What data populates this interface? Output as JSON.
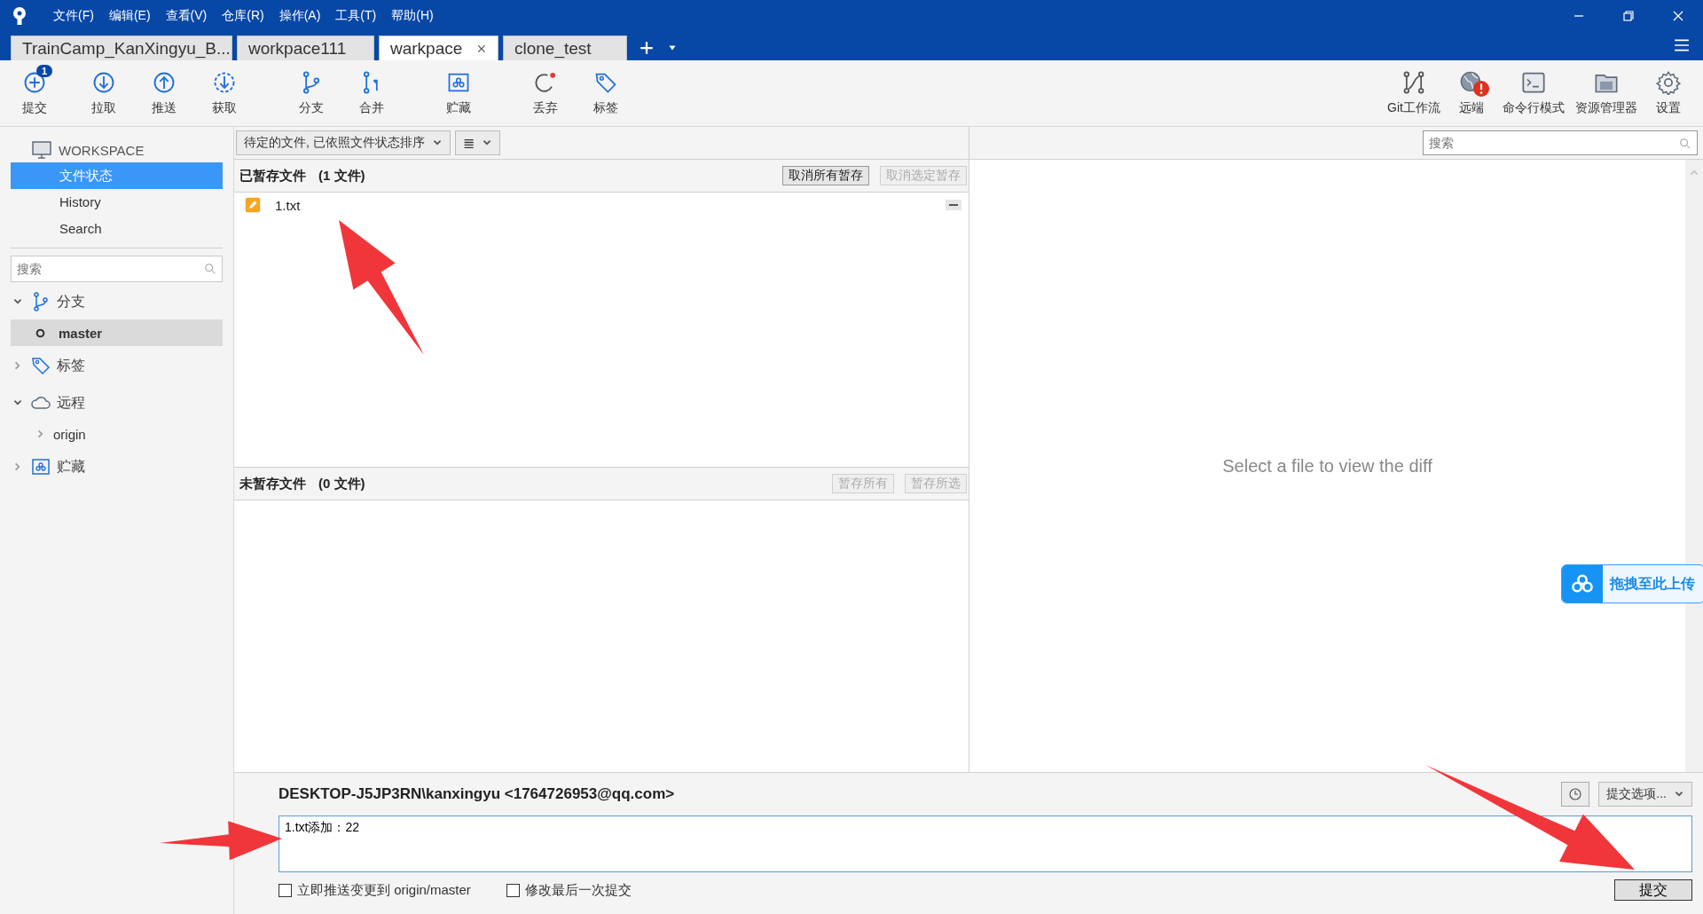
{
  "menu": [
    "文件(F)",
    "编辑(E)",
    "查看(V)",
    "仓库(R)",
    "操作(A)",
    "工具(T)",
    "帮助(H)"
  ],
  "tabs": [
    {
      "label": "TrainCamp_KanXingyu_B...",
      "selected": false
    },
    {
      "label": "workpace111",
      "selected": false
    },
    {
      "label": "warkpace",
      "selected": true
    },
    {
      "label": "clone_test",
      "selected": false
    }
  ],
  "toolbar_left": [
    {
      "label": "提交",
      "kind": "commit",
      "badge": "1"
    },
    {
      "label": "拉取",
      "kind": "pull"
    },
    {
      "label": "推送",
      "kind": "push"
    },
    {
      "label": "获取",
      "kind": "fetch"
    },
    {
      "label": "分支",
      "kind": "branch"
    },
    {
      "label": "合并",
      "kind": "merge"
    },
    {
      "label": "贮藏",
      "kind": "stash"
    },
    {
      "label": "丢弃",
      "kind": "discard"
    },
    {
      "label": "标签",
      "kind": "tag"
    }
  ],
  "toolbar_right": [
    {
      "label": "Git工作流",
      "kind": "flow",
      "alert": false
    },
    {
      "label": "远端",
      "kind": "globe",
      "alert": true
    },
    {
      "label": "命令行模式",
      "kind": "terminal",
      "alert": false
    },
    {
      "label": "资源管理器",
      "kind": "folder",
      "alert": false
    },
    {
      "label": "设置",
      "kind": "gear",
      "alert": false
    }
  ],
  "sidebar": {
    "workspace": "WORKSPACE",
    "items": [
      {
        "label": "文件状态",
        "selected": true
      },
      {
        "label": "History",
        "selected": false
      },
      {
        "label": "Search",
        "selected": false
      }
    ],
    "search": {
      "placeholder": "搜索"
    },
    "sections": [
      {
        "label": "分支",
        "kind": "branch",
        "expanded": true,
        "children": [
          {
            "label": "master",
            "selected": true,
            "kind": "branch"
          }
        ]
      },
      {
        "label": "标签",
        "kind": "tag",
        "expanded": false
      },
      {
        "label": "远程",
        "kind": "cloud",
        "expanded": true,
        "children": [
          {
            "label": "origin",
            "selected": false,
            "kind": "remote"
          }
        ]
      },
      {
        "label": "贮藏",
        "kind": "stash",
        "expanded": false
      }
    ]
  },
  "filter": {
    "sort": "待定的文件, 已依照文件状态排序",
    "view": "≣"
  },
  "staged": {
    "title": "已暂存文件",
    "count": "(1 文件)",
    "buttons": [
      {
        "label": "取消所有暂存",
        "disabled": false
      },
      {
        "label": "取消选定暂存",
        "disabled": true
      }
    ],
    "files": [
      {
        "name": "1.txt",
        "kind": "modified"
      }
    ]
  },
  "unstaged": {
    "title": "未暂存文件",
    "count": "(0 文件)",
    "buttons": [
      {
        "label": "暂存所有",
        "disabled": true
      },
      {
        "label": "暂存所选",
        "disabled": true
      }
    ]
  },
  "diff": {
    "search": {
      "placeholder": "搜索"
    },
    "empty": "Select a file to view the diff"
  },
  "upload_widget": {
    "label": "拖拽至此上传"
  },
  "commit": {
    "author": "DESKTOP-J5JP3RN\\kanxingyu <1764726953@qq.com>",
    "options": "提交选项...",
    "message": "1.txt添加：22",
    "checkboxes": [
      {
        "label": "立即推送变更到 origin/master",
        "checked": false
      },
      {
        "label": "修改最后一次提交",
        "checked": false
      }
    ],
    "submit": "提交"
  }
}
